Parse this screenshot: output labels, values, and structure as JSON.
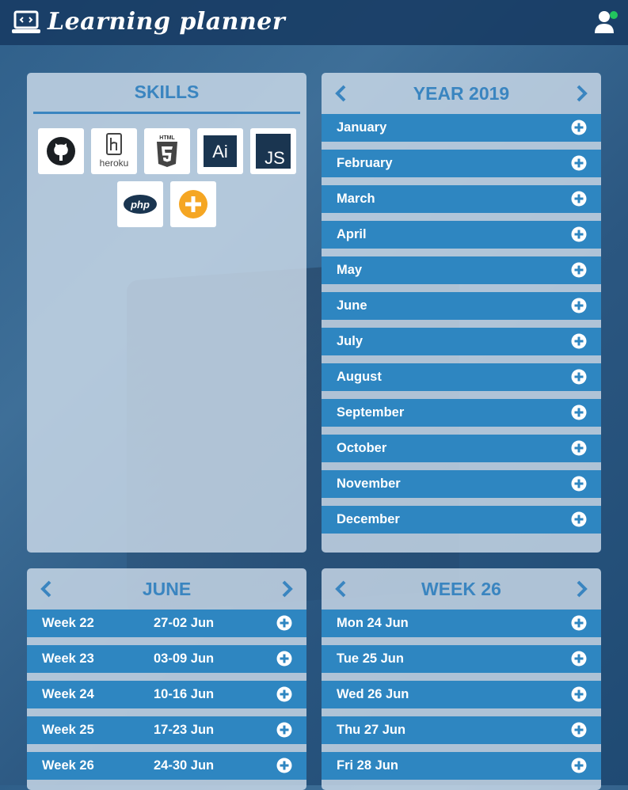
{
  "header": {
    "title": "Learning planner"
  },
  "skills": {
    "title": "SKILLS",
    "items": [
      {
        "name": "github"
      },
      {
        "name": "heroku",
        "label": "heroku"
      },
      {
        "name": "html5",
        "label": "HTML"
      },
      {
        "name": "illustrator",
        "label": "Ai"
      },
      {
        "name": "javascript",
        "label": "JS"
      },
      {
        "name": "php",
        "label": "php"
      },
      {
        "name": "add-skill"
      }
    ]
  },
  "year": {
    "title": "YEAR 2019",
    "months": [
      "January",
      "February",
      "March",
      "April",
      "May",
      "June",
      "July",
      "August",
      "September",
      "October",
      "November",
      "December"
    ]
  },
  "month": {
    "title": "JUNE",
    "weeks": [
      {
        "label": "Week 22",
        "range": "27-02 Jun"
      },
      {
        "label": "Week 23",
        "range": "03-09 Jun"
      },
      {
        "label": "Week 24",
        "range": "10-16 Jun"
      },
      {
        "label": "Week 25",
        "range": "17-23 Jun"
      },
      {
        "label": "Week 26",
        "range": "24-30 Jun"
      }
    ]
  },
  "week": {
    "title": "WEEK 26",
    "days": [
      "Mon 24 Jun",
      "Tue 25 Jun",
      "Wed 26 Jun",
      "Thu 27 Jun",
      "Fri 28 Jun"
    ]
  },
  "colors": {
    "accent": "#3a85c0",
    "row": "#2e86c1",
    "status_online": "#22c55e",
    "add_skill": "#f5a623"
  }
}
